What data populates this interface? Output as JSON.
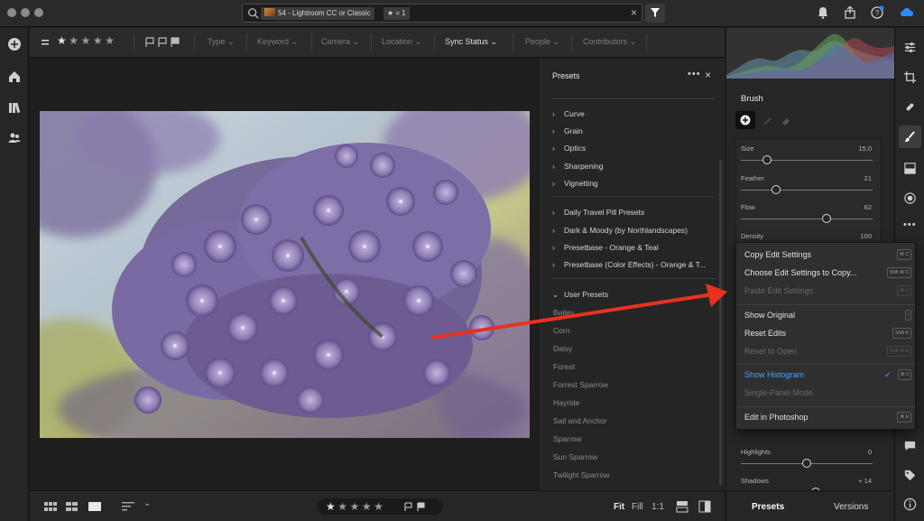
{
  "titlebar": {
    "search_chip_album": "54 - Lightroom CC or Classic",
    "search_chip_rating": "★ = 1",
    "clear_glyph": "×"
  },
  "filterbar": {
    "stars": [
      "★",
      "★",
      "★",
      "★",
      "★"
    ],
    "type_label": "Type",
    "keyword_label": "Keyword",
    "camera_label": "Camera",
    "location_label": "Location",
    "sync_label": "Sync Status",
    "people_label": "People",
    "contributors_label": "Contributors"
  },
  "presets": {
    "title": "Presets",
    "more": "•••",
    "close": "×",
    "groups_a": [
      "Curve",
      "Grain",
      "Optics",
      "Sharpening",
      "Vignetting"
    ],
    "groups_b": [
      "Daily Travel Pill Presets",
      "Dark & Moody (by Northlandscapes)",
      "Presetbase - Orange & Teal",
      "Presetbase (Color Effects) - Orange & T..."
    ],
    "user_presets_label": "User Presets",
    "user_presets": [
      "Bailey",
      "Corn",
      "Daisy",
      "Forest",
      "Forrest Sparrow",
      "Hayride",
      "Sail and Anchor",
      "Sparrow",
      "Sun Sparrow",
      "Twilight Sparrow"
    ]
  },
  "bottombar": {
    "fit": "Fit",
    "fill": "Fill",
    "one_to_one": "1:1",
    "stars": [
      "★",
      "★",
      "★",
      "★",
      "★"
    ]
  },
  "rightpanel": {
    "title": "Brush",
    "sliders": [
      {
        "label": "Size",
        "value": "15,0",
        "fraction": 0.2
      },
      {
        "label": "Feather",
        "value": "21",
        "fraction": 0.27
      },
      {
        "label": "Flow",
        "value": "62",
        "fraction": 0.65
      },
      {
        "label": "Density",
        "value": "100",
        "fraction": 1.0
      }
    ],
    "lower_sliders": [
      {
        "label": "Highlights",
        "value": "0",
        "fraction": 0.5
      },
      {
        "label": "Shadows",
        "value": "+ 14",
        "fraction": 0.57
      }
    ]
  },
  "contextmenu": {
    "items": [
      {
        "label": "Copy Edit Settings",
        "shortcut": "⌘ C",
        "enabled": true
      },
      {
        "label": "Choose Edit Settings to Copy...",
        "shortcut": "Shift ⌘ C",
        "enabled": true
      },
      {
        "label": "Paste Edit Settings",
        "shortcut": "⌘ V",
        "enabled": false
      },
      {
        "label": "Show Original",
        "shortcut": "\\",
        "enabled": true
      },
      {
        "label": "Reset Edits",
        "shortcut": "Shift R",
        "enabled": true
      },
      {
        "label": "Reset to Open",
        "shortcut": "Shift ⌘ R",
        "enabled": false
      },
      {
        "label": "Show Histogram",
        "shortcut": "⌘ 0",
        "enabled": true,
        "checked": true
      },
      {
        "label": "Single-Panel Mode",
        "shortcut": "",
        "enabled": false
      },
      {
        "label": "Edit in Photoshop",
        "shortcut": "⌘ E",
        "enabled": true
      }
    ],
    "check_glyph": "✓"
  },
  "tabs": {
    "presets": "Presets",
    "versions": "Versions"
  },
  "colors": {
    "accent": "#4ba0ff",
    "arrow": "#e8321f",
    "lilac": "#8a7bb0"
  }
}
